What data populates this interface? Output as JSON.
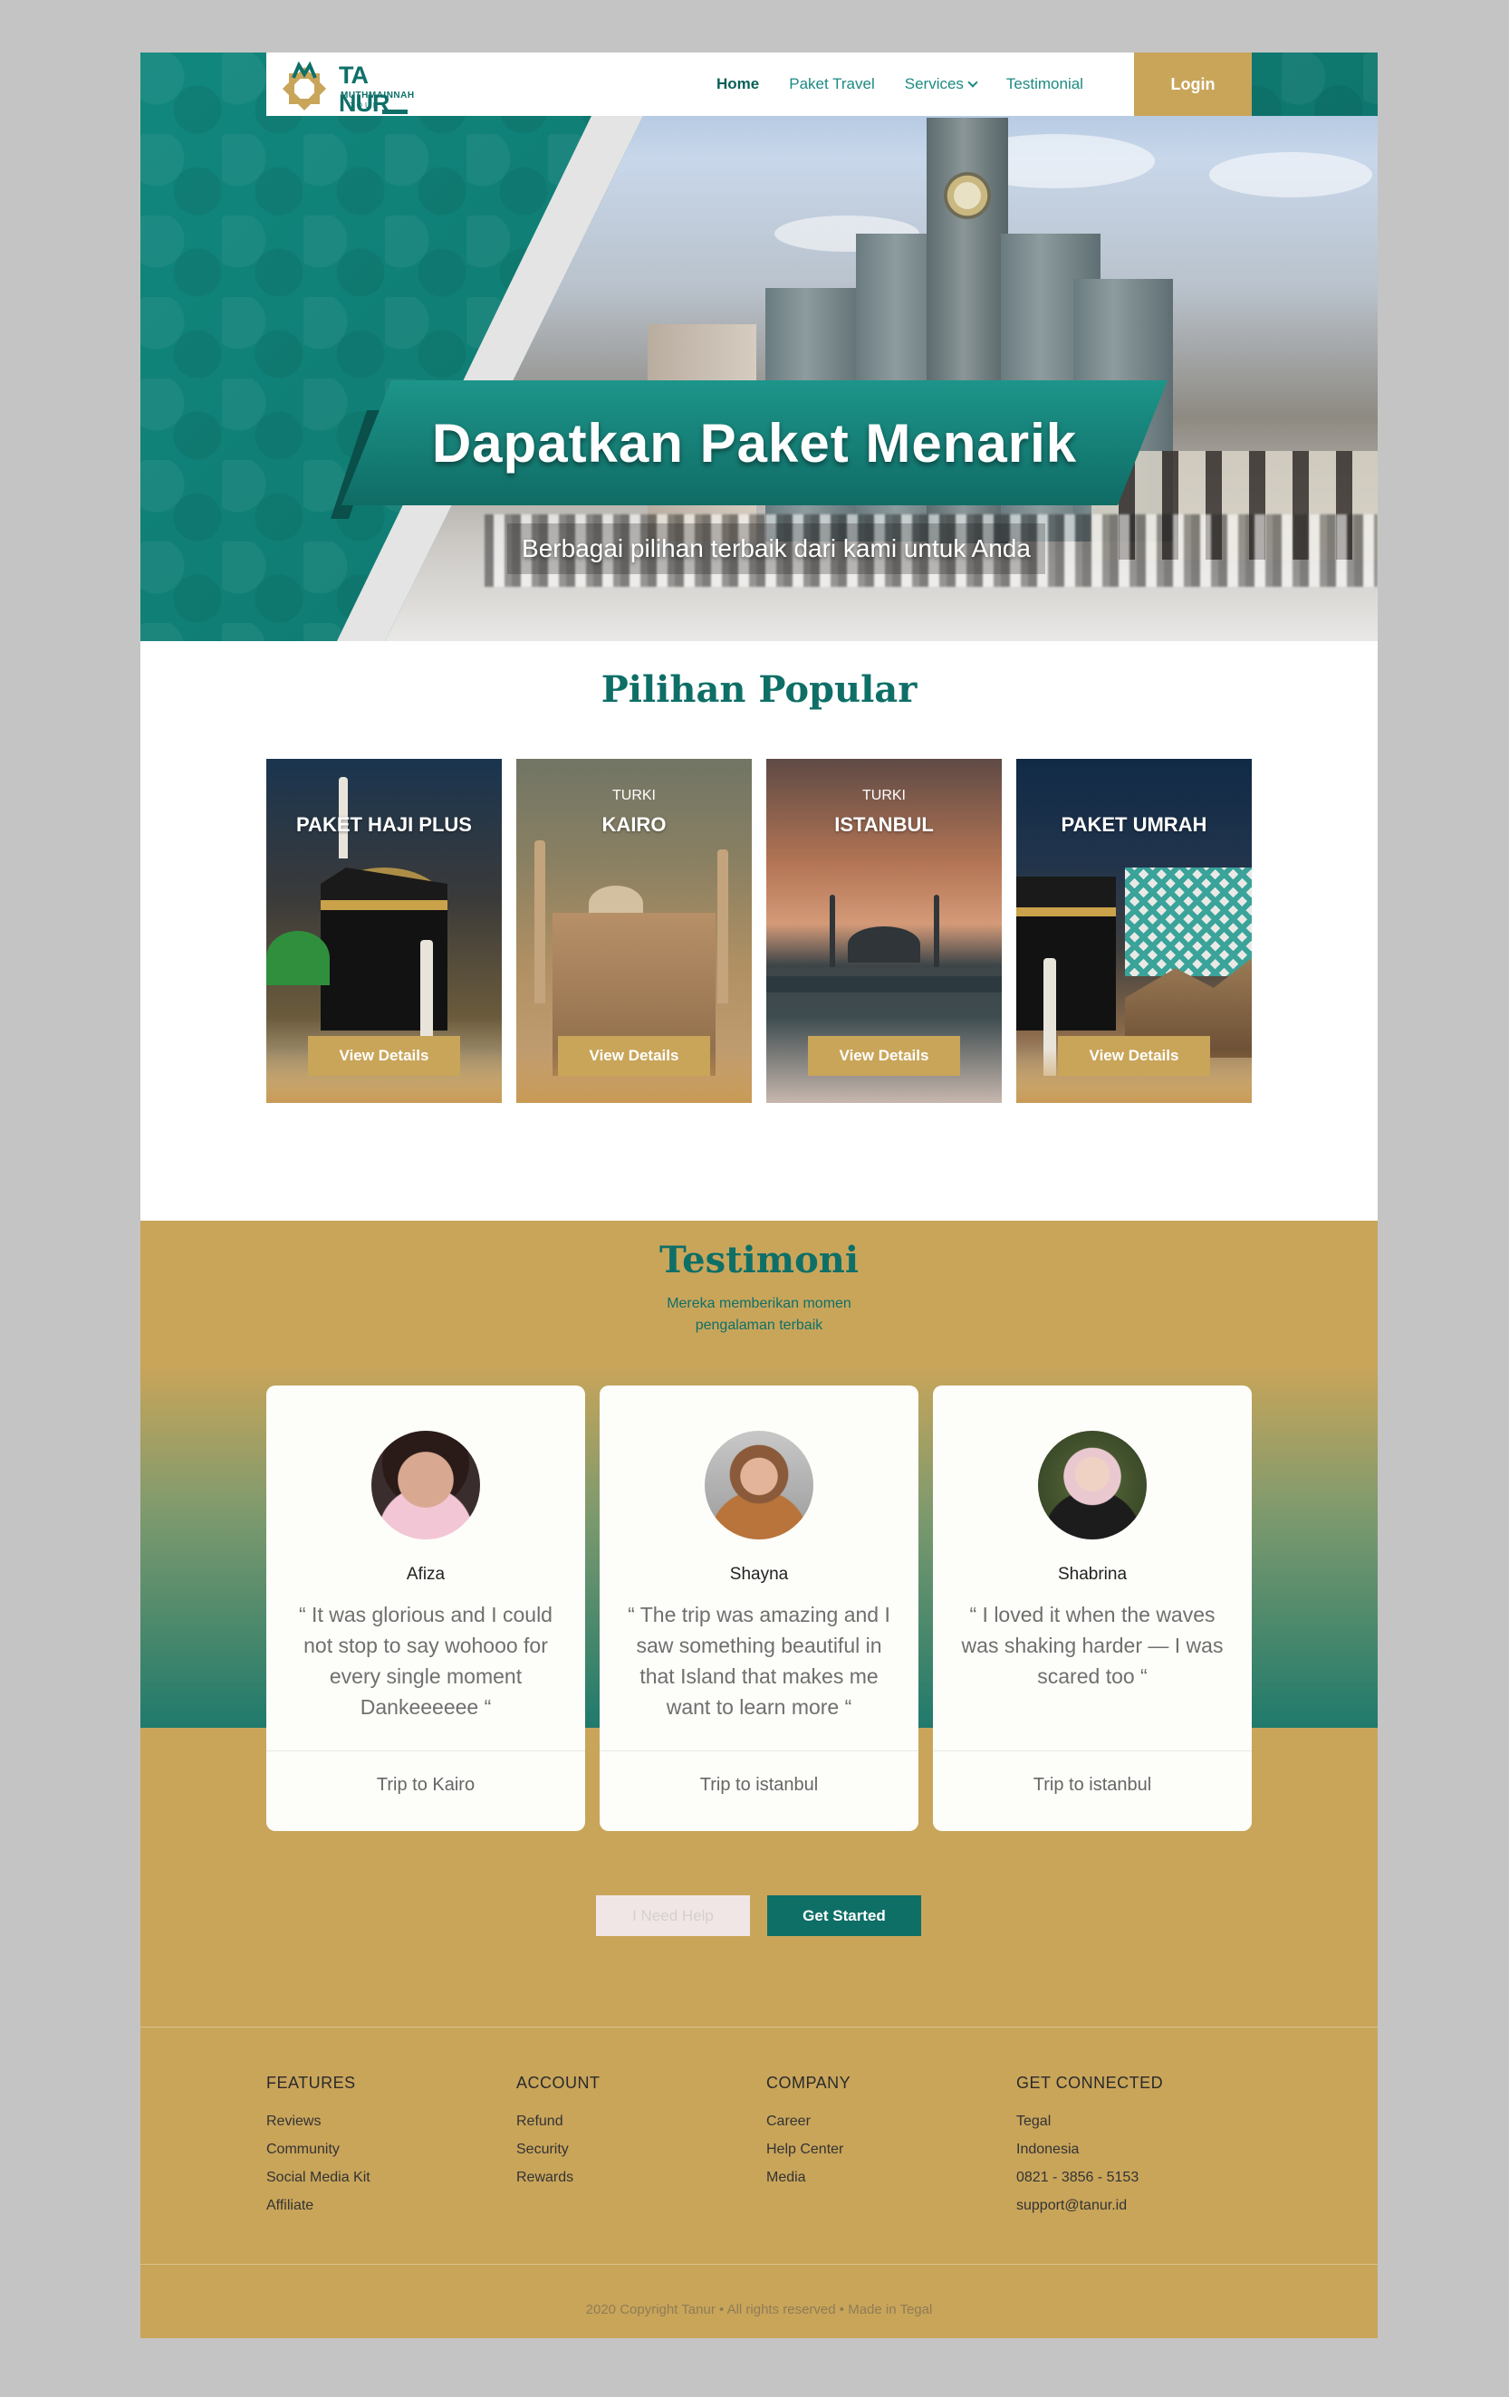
{
  "nav": {
    "logo_name": "TA NUR",
    "logo_sub": "MUTHMAINNAH",
    "logo_tour": "TOUR",
    "links": [
      "Home",
      "Paket Travel",
      "Services",
      "Testimonial"
    ],
    "login": "Login"
  },
  "hero": {
    "title": "Dapatkan Paket Menarik",
    "subtitle": "Berbagai pilihan terbaik dari kami untuk Anda"
  },
  "popular": {
    "title": "Pilihan Popular",
    "cards": [
      {
        "category": "",
        "name": "PAKET HAJI PLUS",
        "button": "View Details"
      },
      {
        "category": "TURKI",
        "name": "KAIRO",
        "button": "View Details"
      },
      {
        "category": "TURKI",
        "name": "ISTANBUL",
        "button": "View Details"
      },
      {
        "category": "",
        "name": "PAKET UMRAH",
        "button": "View Details"
      }
    ]
  },
  "testimoni": {
    "title": "Testimoni",
    "subtitle_line1": "Mereka memberikan momen",
    "subtitle_line2": "pengalaman terbaik",
    "items": [
      {
        "name": "Afiza",
        "quote": "“ It was glorious and I could not stop to say wohooo for every single moment Dankeeeeee “",
        "trip": "Trip to Kairo"
      },
      {
        "name": "Shayna",
        "quote": "“ The trip was amazing and I saw something beautiful in that Island that makes me want to learn more “",
        "trip": "Trip to istanbul"
      },
      {
        "name": "Shabrina",
        "quote": "“ I loved it when the waves was shaking harder — I was scared too “",
        "trip": "Trip to istanbul"
      }
    ],
    "help_button": "I Need Help",
    "start_button": "Get Started"
  },
  "footer": {
    "columns": [
      {
        "title": "FEATURES",
        "items": [
          "Reviews",
          "Community",
          "Social Media Kit",
          "Affiliate"
        ]
      },
      {
        "title": "ACCOUNT",
        "items": [
          "Refund",
          "Security",
          "Rewards"
        ]
      },
      {
        "title": "COMPANY",
        "items": [
          "Career",
          "Help Center",
          "Media"
        ]
      },
      {
        "title": "GET CONNECTED",
        "items": [
          "Tegal",
          "Indonesia",
          "0821 - 3856 - 5153",
          "support@tanur.id"
        ]
      }
    ],
    "copyright": "2020 Copyright Tanur • All rights reserved • Made in Tegal"
  },
  "colors": {
    "teal": "#0e6f67",
    "gold": "#c9a55a",
    "page_background": "#c4c4c4"
  }
}
